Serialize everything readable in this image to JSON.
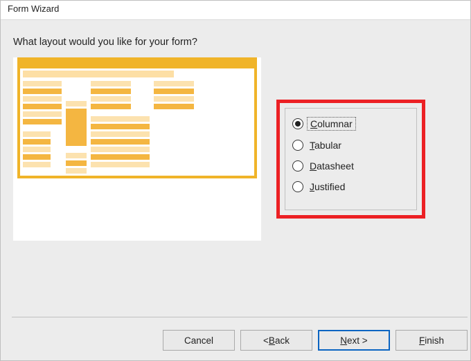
{
  "window": {
    "title": "Form Wizard"
  },
  "question": "What layout would you like for your form?",
  "layoutOptions": {
    "columnar": {
      "label": "Columnar",
      "mnemonic": "C",
      "rest": "olumnar",
      "selected": true
    },
    "tabular": {
      "label": "Tabular",
      "mnemonic": "T",
      "rest": "abular",
      "selected": false
    },
    "datasheet": {
      "label": "Datasheet",
      "mnemonic": "D",
      "rest": "atasheet",
      "selected": false
    },
    "justified": {
      "label": "Justified",
      "mnemonic": "J",
      "rest": "ustified",
      "selected": false
    }
  },
  "buttons": {
    "cancel": {
      "label": "Cancel"
    },
    "back": {
      "prefix": "< ",
      "mnemonic": "B",
      "rest": "ack"
    },
    "next": {
      "mnemonic": "N",
      "rest": "ext >"
    },
    "finish": {
      "mnemonic": "F",
      "rest": "inish"
    }
  }
}
